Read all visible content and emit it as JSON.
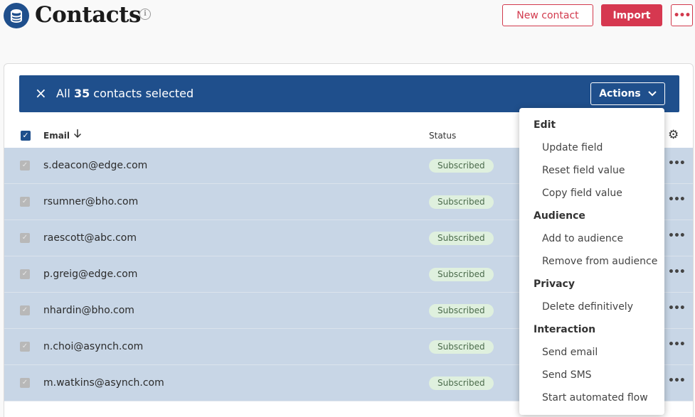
{
  "header": {
    "title": "Contacts",
    "info_icon": "i",
    "new_contact_label": "New contact",
    "import_label": "Import",
    "more_label": "•••"
  },
  "selection": {
    "close_icon": "×",
    "prefix": "All",
    "count": "35",
    "suffix": "contacts selected",
    "actions_label": "Actions"
  },
  "table": {
    "columns": {
      "email": "Email",
      "status": "Status"
    },
    "rows": [
      {
        "email": "s.deacon@edge.com",
        "status": "Subscribed"
      },
      {
        "email": "rsumner@bho.com",
        "status": "Subscribed"
      },
      {
        "email": "raescott@abc.com",
        "status": "Subscribed"
      },
      {
        "email": "p.greig@edge.com",
        "status": "Subscribed"
      },
      {
        "email": "nhardin@bho.com",
        "status": "Subscribed"
      },
      {
        "email": "n.choi@asynch.com",
        "status": "Subscribed"
      },
      {
        "email": "m.watkins@asynch.com",
        "status": "Subscribed"
      }
    ]
  },
  "actions_menu": {
    "groups": [
      {
        "label": "Edit",
        "items": [
          "Update field",
          "Reset field value",
          "Copy field value"
        ]
      },
      {
        "label": "Audience",
        "items": [
          "Add to audience",
          "Remove from audience"
        ]
      },
      {
        "label": "Privacy",
        "items": [
          "Delete definitively"
        ]
      },
      {
        "label": "Interaction",
        "items": [
          "Send email",
          "Send SMS",
          "Start automated flow"
        ]
      }
    ]
  },
  "icons": {
    "brand": "database-icon",
    "info": "info-icon",
    "close": "close-icon",
    "chevron": "chevron-down-icon",
    "sort": "arrow-down-icon",
    "settings": "gear-icon",
    "row_more": "ellipsis-icon"
  },
  "colors": {
    "brand_blue": "#1f4f8c",
    "accent_red": "#d63850",
    "row_selected": "#c8d6e6",
    "status_badge": "#dff0de"
  }
}
